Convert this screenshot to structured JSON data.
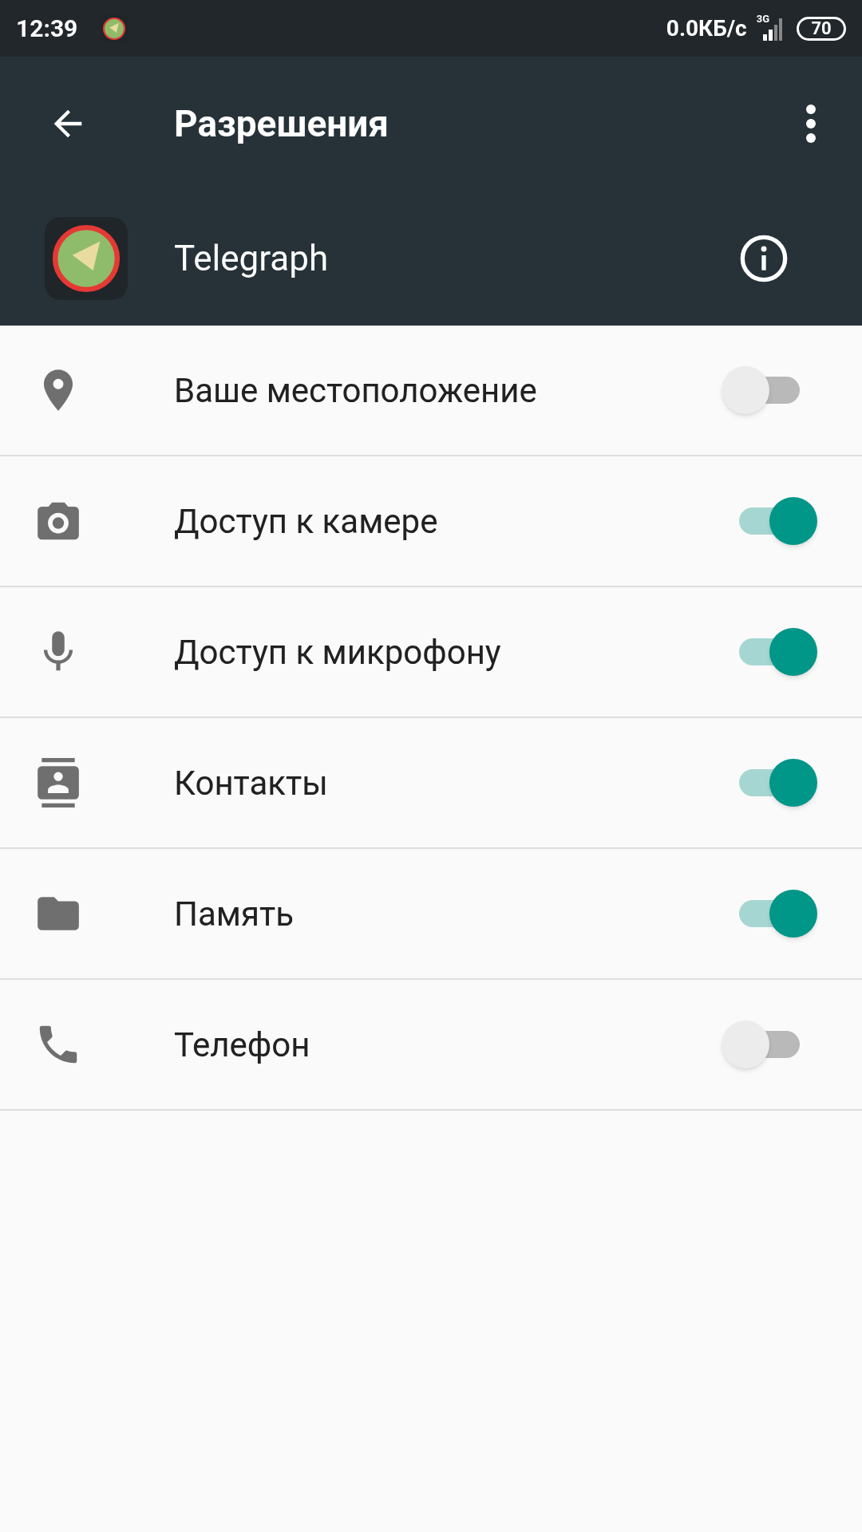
{
  "status_bar": {
    "time": "12:39",
    "network_speed": "0.0КБ/с",
    "network_type": "3G",
    "battery": "70"
  },
  "toolbar": {
    "title": "Разрешения"
  },
  "app": {
    "name": "Telegraph"
  },
  "permissions": [
    {
      "label": "Ваше местоположение",
      "on": false
    },
    {
      "label": "Доступ к камере",
      "on": true
    },
    {
      "label": "Доступ к микрофону",
      "on": true
    },
    {
      "label": "Контакты",
      "on": true
    },
    {
      "label": "Память",
      "on": true
    },
    {
      "label": "Телефон",
      "on": false
    }
  ]
}
